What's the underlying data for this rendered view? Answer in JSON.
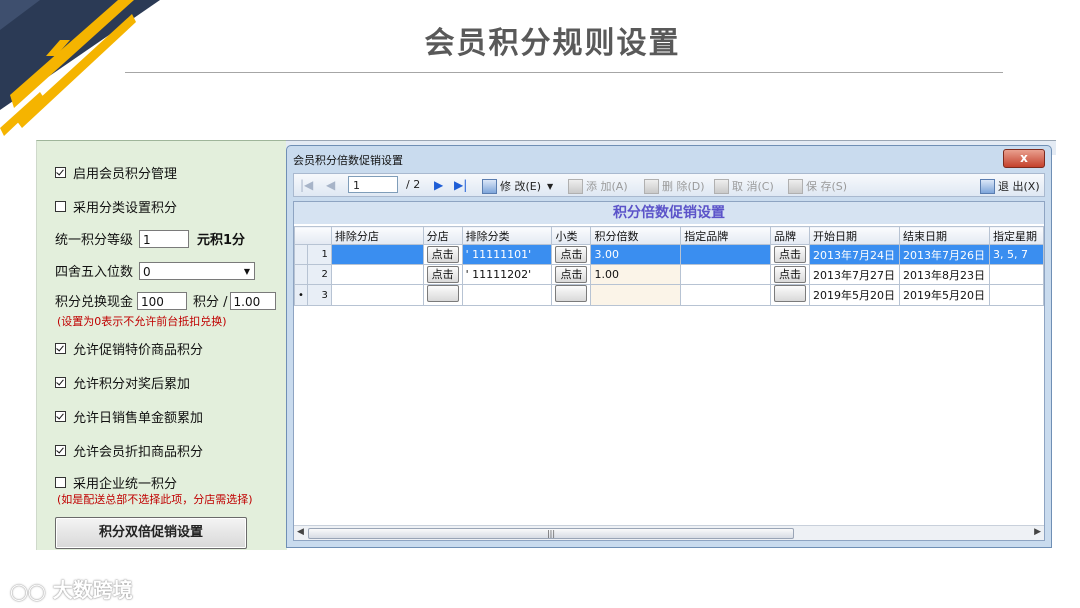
{
  "slide": {
    "title": "会员积分规则设置"
  },
  "settings": {
    "enable_points": {
      "label": "启用会员积分管理",
      "checked": true
    },
    "category_points": {
      "label": "采用分类设置积分",
      "checked": false
    },
    "unified_level_label": "统一积分等级",
    "unified_level_value": "1",
    "unified_level_unit": "元积1分",
    "rounding_label": "四舍五入位数",
    "rounding_value": "0",
    "exchange_label": "积分兑换现金",
    "exchange_value": "100",
    "exchange_mid": "积分 /",
    "exchange_cash": "1.00",
    "exchange_note": "(设置为0表示不允许前台抵扣兑换)",
    "allow_promo": {
      "label": "允许促销特价商品积分",
      "checked": true
    },
    "allow_award": {
      "label": "允许积分对奖后累加",
      "checked": true
    },
    "allow_daily": {
      "label": "允许日销售单金额累加",
      "checked": true
    },
    "allow_discount": {
      "label": "允许会员折扣商品积分",
      "checked": true
    },
    "enterprise": {
      "label": "采用企业统一积分",
      "checked": false
    },
    "enterprise_note": "(如是配送总部不选择此项，分店需选择)",
    "promo_button": "积分双倍促销设置"
  },
  "dialog": {
    "title": "会员积分倍数促销设置",
    "close_label": "x",
    "grid_title": "积分倍数促销设置",
    "toolbar": {
      "page_current": "1",
      "page_total": "/ 2",
      "edit": "修 改(E)",
      "add": "添 加(A)",
      "delete": "删 除(D)",
      "cancel": "取 消(C)",
      "save": "保 存(S)",
      "exit": "退 出(X)"
    },
    "columns": [
      "",
      "排除分店",
      "分店",
      "排除分类",
      "小类",
      "积分倍数",
      "指定品牌",
      "品牌",
      "开始日期",
      "结束日期",
      "指定星期"
    ],
    "click_label": "点击",
    "rows": [
      {
        "marker": "",
        "num": "1",
        "store_ex": "",
        "category_ex": "' 11111101'",
        "multiple": "3.00",
        "brand": "",
        "start": "2013年7月24日",
        "end": "2013年7月26日",
        "weekday": "3, 5, 7",
        "selected": true
      },
      {
        "marker": "",
        "num": "2",
        "store_ex": "",
        "category_ex": "' 11111202'",
        "multiple": "1.00",
        "brand": "",
        "start": "2013年7月27日",
        "end": "2013年8月23日",
        "weekday": "",
        "selected": false
      },
      {
        "marker": "•",
        "num": "3",
        "store_ex": "",
        "category_ex": "",
        "multiple": "",
        "brand": "",
        "start": "2019年5月20日",
        "end": "2019年5月20日",
        "weekday": "",
        "selected": false
      }
    ]
  },
  "watermark": "大数跨境",
  "colors": {
    "accent": "#3a8ef0",
    "corner_dark": "#2b3a55",
    "corner_yellow": "#f5b400",
    "panel_bg": "#e3efdc",
    "note_red": "#c00000"
  }
}
